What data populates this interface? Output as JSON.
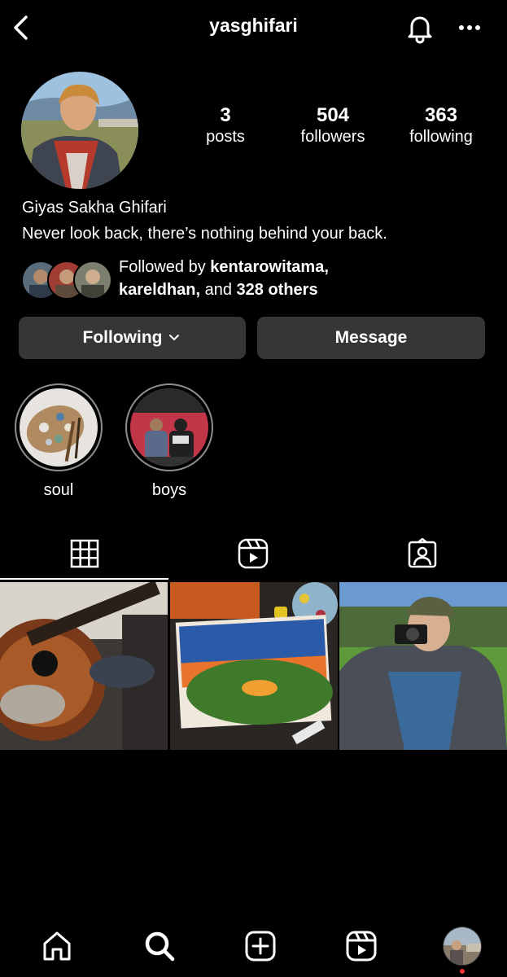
{
  "header": {
    "username": "yasghifari"
  },
  "profile": {
    "stats": [
      {
        "value": "3",
        "label": "posts"
      },
      {
        "value": "504",
        "label": "followers"
      },
      {
        "value": "363",
        "label": "following"
      }
    ],
    "full_name": "Giyas Sakha Ghifari",
    "bio": "Never look back, there’s nothing behind your back.",
    "followed_by": {
      "prefix": "Followed by ",
      "user1": "kentarowitama,",
      "user2": "kareldhan,",
      "mid": " and ",
      "others": "328 others"
    }
  },
  "buttons": {
    "following": "Following",
    "message": "Message"
  },
  "highlights": [
    {
      "label": "soul"
    },
    {
      "label": "boys"
    }
  ],
  "colors": {
    "background": "#000000",
    "button": "#363636",
    "notification_dot": "#ff3040"
  }
}
